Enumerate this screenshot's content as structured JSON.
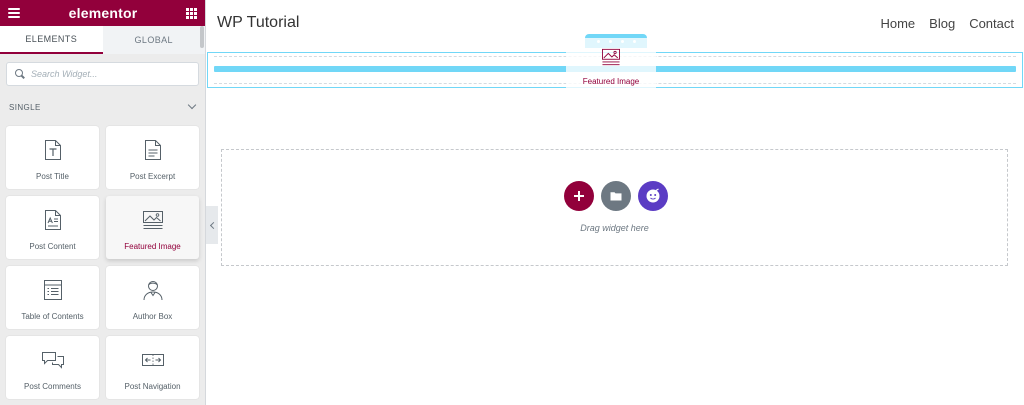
{
  "sidebar": {
    "brand": "elementor",
    "tabs": [
      {
        "label": "ELEMENTS",
        "active": true
      },
      {
        "label": "GLOBAL",
        "active": false
      }
    ],
    "search": {
      "placeholder": "Search Widget..."
    },
    "section_title": "SINGLE",
    "widgets": [
      {
        "label": "Post Title",
        "icon": "post-title-icon"
      },
      {
        "label": "Post Excerpt",
        "icon": "post-excerpt-icon"
      },
      {
        "label": "Post Content",
        "icon": "post-content-icon"
      },
      {
        "label": "Featured Image",
        "icon": "featured-image-icon"
      },
      {
        "label": "Table of Contents",
        "icon": "table-of-contents-icon"
      },
      {
        "label": "Author Box",
        "icon": "author-box-icon"
      },
      {
        "label": "Post Comments",
        "icon": "post-comments-icon"
      },
      {
        "label": "Post Navigation",
        "icon": "post-navigation-icon"
      }
    ]
  },
  "canvas": {
    "site_title": "WP Tutorial",
    "nav": [
      "Home",
      "Blog",
      "Contact"
    ],
    "drag_ghost_label": "Featured Image",
    "drag_hint": "Drag widget here"
  },
  "colors": {
    "brand": "#92003b",
    "drop_highlight": "#71d7f7",
    "folder_button": "#6d7882",
    "ai_button": "#5b3cc4"
  }
}
